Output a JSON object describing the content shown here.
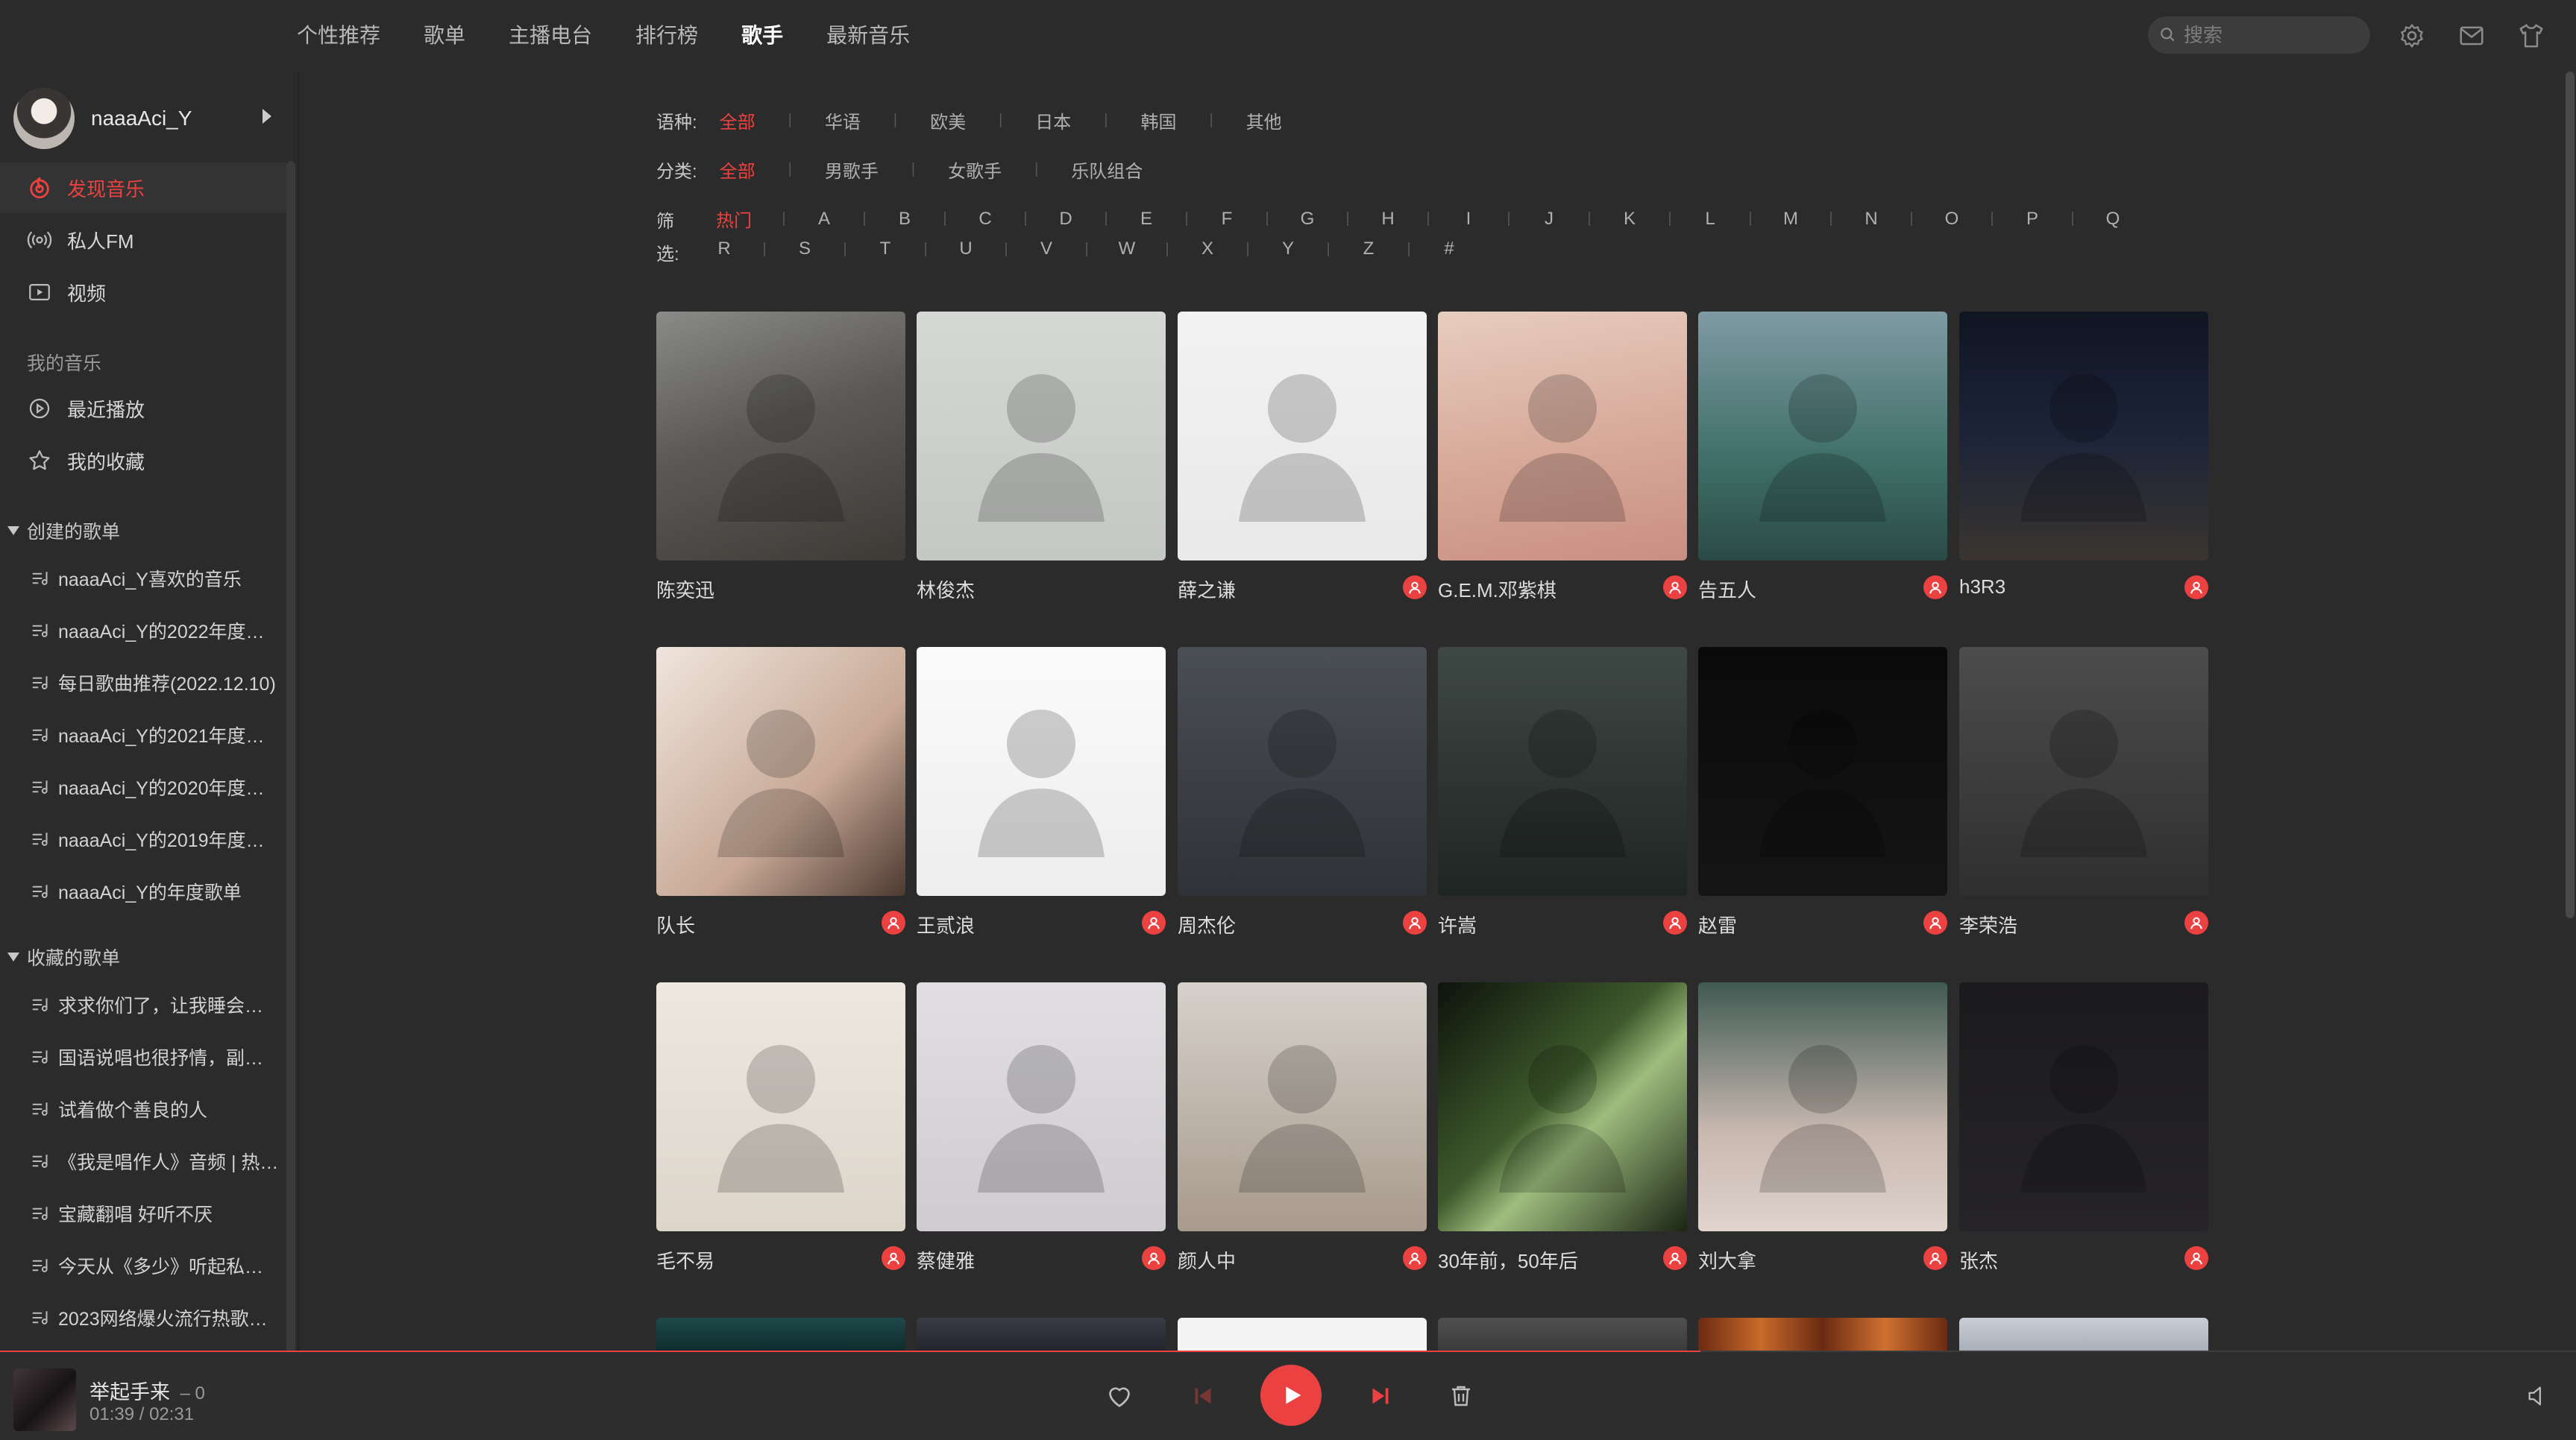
{
  "nav": {
    "tabs": [
      {
        "label": "个性推荐"
      },
      {
        "label": "歌单"
      },
      {
        "label": "主播电台"
      },
      {
        "label": "排行榜"
      },
      {
        "label": "歌手"
      },
      {
        "label": "最新音乐"
      }
    ],
    "active_tab": "歌手",
    "search_placeholder": "搜索"
  },
  "sidebar": {
    "username": "naaaAci_Y",
    "items": [
      {
        "label": "发现音乐",
        "icon": "netease-music-icon",
        "active": true
      },
      {
        "label": "私人FM",
        "icon": "radio-icon"
      },
      {
        "label": "视频",
        "icon": "video-icon"
      }
    ],
    "my_music_label": "我的音乐",
    "my_music_items": [
      {
        "label": "最近播放",
        "icon": "recent-play-icon"
      },
      {
        "label": "我的收藏",
        "icon": "star-icon"
      }
    ],
    "created_playlists_label": "创建的歌单",
    "created_playlists": [
      "naaaAci_Y喜欢的音乐",
      "naaaAci_Y的2022年度…",
      "每日歌曲推荐(2022.12.10)",
      "naaaAci_Y的2021年度…",
      "naaaAci_Y的2020年度…",
      "naaaAci_Y的2019年度…",
      "naaaAci_Y的年度歌单"
    ],
    "collected_playlists_label": "收藏的歌单",
    "collected_playlists": [
      "求求你们了，让我睡会…",
      "国语说唱也很抒情，副…",
      "试着做个善良的人",
      "《我是唱作人》音频 | 热…",
      "宝藏翻唱 好听不厌",
      "今天从《多少》听起私…",
      "2023网络爆火流行热歌…"
    ]
  },
  "filters": {
    "language_label": "语种:",
    "language_options": [
      "全部",
      "华语",
      "欧美",
      "日本",
      "韩国",
      "其他"
    ],
    "category_label": "分类:",
    "category_options": [
      "全部",
      "男歌手",
      "女歌手",
      "乐队组合"
    ],
    "letter_label_1": "筛",
    "letter_label_2": "选:",
    "letters_row1": [
      "热门",
      "A",
      "B",
      "C",
      "D",
      "E",
      "F",
      "G",
      "H",
      "I",
      "J",
      "K",
      "L",
      "M",
      "N",
      "O",
      "P",
      "Q"
    ],
    "letters_row2": [
      "R",
      "S",
      "T",
      "U",
      "V",
      "W",
      "X",
      "Y",
      "Z",
      "#"
    ]
  },
  "artists": [
    {
      "name": "陈奕迅",
      "badge": false
    },
    {
      "name": "林俊杰",
      "badge": false
    },
    {
      "name": "薛之谦",
      "badge": true
    },
    {
      "name": "G.E.M.邓紫棋",
      "badge": true
    },
    {
      "name": "告五人",
      "badge": true
    },
    {
      "name": "h3R3",
      "badge": true
    },
    {
      "name": "队长",
      "badge": true
    },
    {
      "name": "王贰浪",
      "badge": true
    },
    {
      "name": "周杰伦",
      "badge": true
    },
    {
      "name": "许嵩",
      "badge": true
    },
    {
      "name": "赵雷",
      "badge": true
    },
    {
      "name": "李荣浩",
      "badge": true
    },
    {
      "name": "毛不易",
      "badge": true
    },
    {
      "name": "蔡健雅",
      "badge": true
    },
    {
      "name": "颜人中",
      "badge": true
    },
    {
      "name": "30年前，50年后",
      "badge": true
    },
    {
      "name": "刘大拿",
      "badge": true
    },
    {
      "name": "张杰",
      "badge": true
    }
  ],
  "player": {
    "title": "举起手来",
    "artist": "– 0",
    "time": "01:39 / 02:31",
    "progress": 0.66
  },
  "colors": {
    "accent": "#ec4141",
    "background": "#2b2b2b",
    "text": "#dcdcdc"
  }
}
